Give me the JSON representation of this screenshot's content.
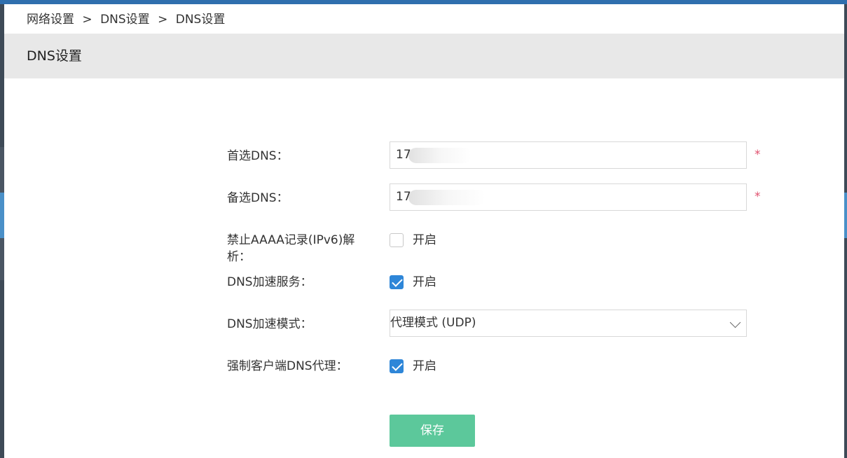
{
  "breadcrumb": {
    "items": [
      "网络设置",
      "DNS设置",
      "DNS设置"
    ],
    "separator": ">"
  },
  "section": {
    "title": "DNS设置"
  },
  "form": {
    "primary_dns": {
      "label": "首选DNS：",
      "value": "17",
      "required_mark": "*"
    },
    "secondary_dns": {
      "label": "备选DNS：",
      "value": "17",
      "required_mark": "*"
    },
    "block_aaaa": {
      "label": "禁止AAAA记录(IPv6)解析：",
      "option": "开启",
      "checked": false
    },
    "dns_acceleration": {
      "label": "DNS加速服务：",
      "option": "开启",
      "checked": true
    },
    "acceleration_mode": {
      "label": "DNS加速模式：",
      "selected": "代理模式 (UDP)"
    },
    "force_client_proxy": {
      "label": "强制客户端DNS代理：",
      "option": "开启",
      "checked": true
    }
  },
  "actions": {
    "save_label": "保存"
  },
  "colors": {
    "accent_blue": "#2e86d8",
    "save_button": "#5cc89b",
    "required": "#e0506e",
    "header_bg": "#e8e8e8"
  }
}
